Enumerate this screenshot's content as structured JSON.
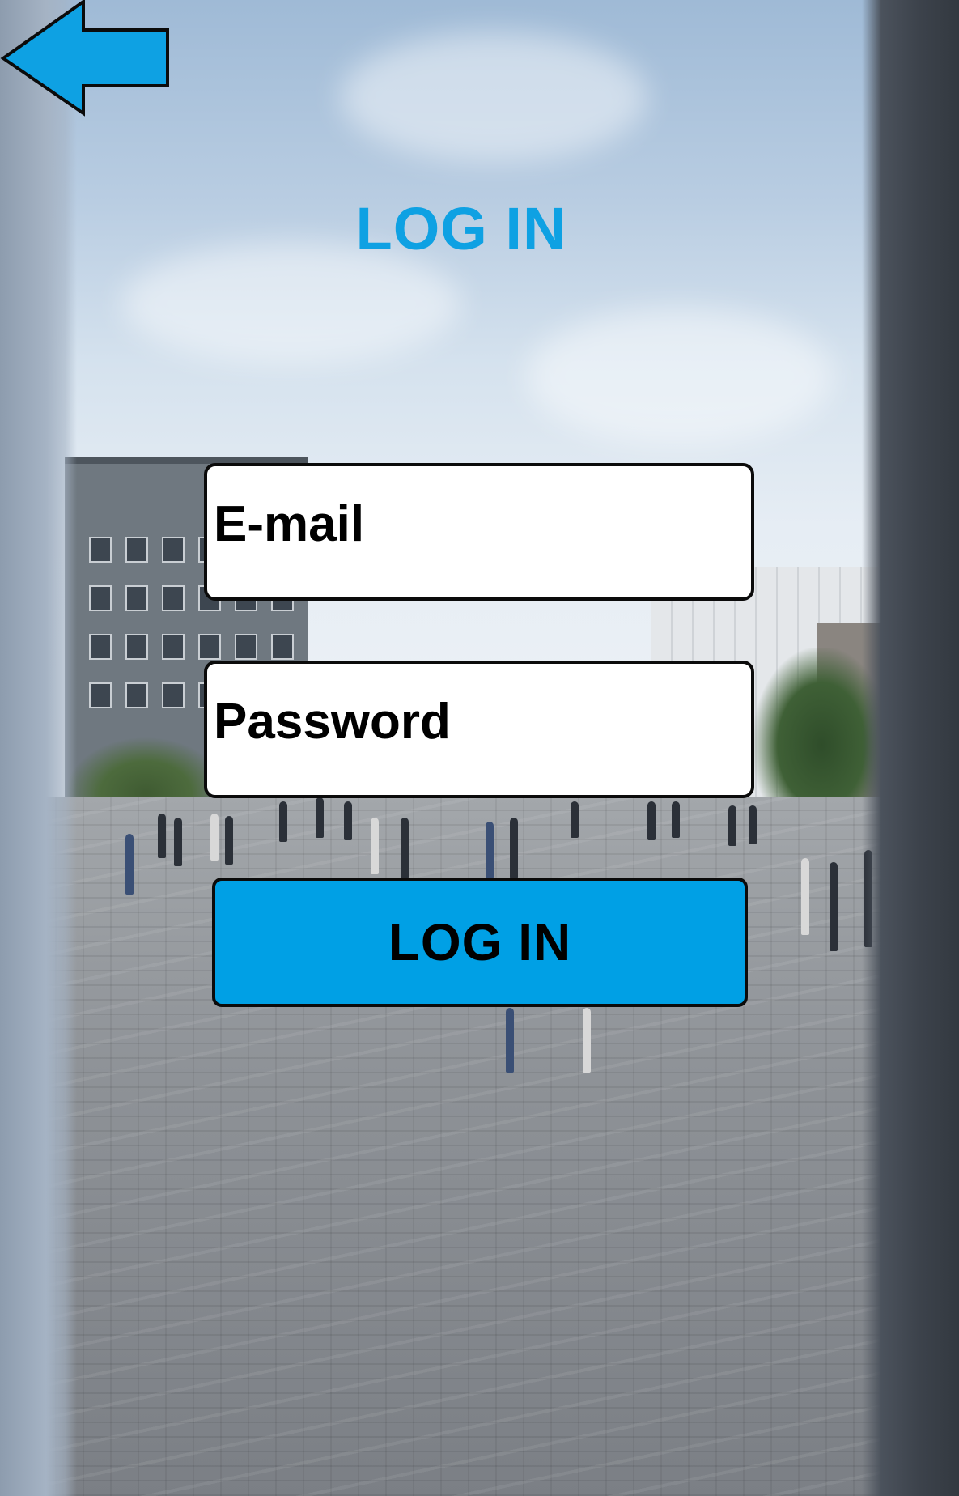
{
  "header": {
    "back_icon": "left-arrow-icon",
    "title": "LOG IN"
  },
  "form": {
    "email_placeholder": "E-mail",
    "email_value": "",
    "password_placeholder": "Password",
    "password_value": "",
    "submit_label": "LOG IN"
  },
  "colors": {
    "accent": "#00A0E5",
    "title": "#0EA1E3",
    "field_background": "#FFFFFF",
    "border": "#0B0B0B"
  },
  "background": {
    "description_icon": "campus-plaza-photo"
  }
}
